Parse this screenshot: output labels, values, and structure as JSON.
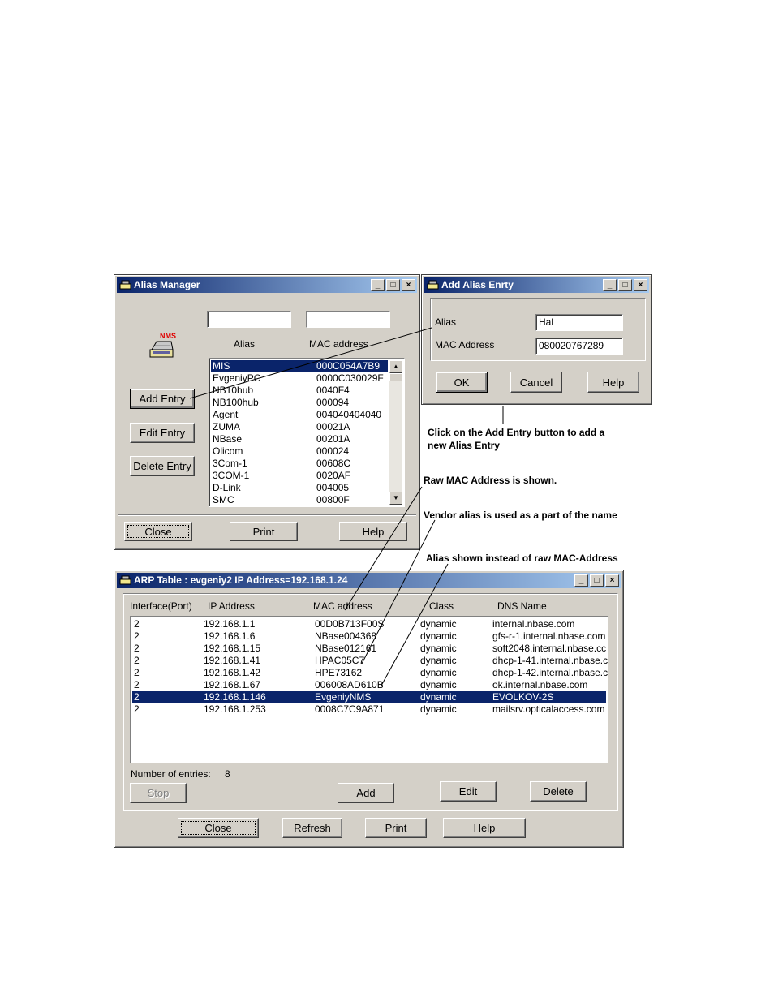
{
  "alias_manager": {
    "title": "Alias Manager",
    "col_alias": "Alias",
    "col_mac": "MAC address",
    "icon_badge": "NMS",
    "buttons": {
      "add": "Add Entry",
      "edit": "Edit Entry",
      "delete": "Delete Entry",
      "close": "Close",
      "print": "Print",
      "help": "Help"
    },
    "rows": [
      {
        "alias": "MIS",
        "mac": "000C054A7B9",
        "selected": true
      },
      {
        "alias": "EvgeniyPC",
        "mac": "0000C030029F"
      },
      {
        "alias": "NB10hub",
        "mac": "0040F4"
      },
      {
        "alias": "NB100hub",
        "mac": "000094"
      },
      {
        "alias": "Agent",
        "mac": "004040404040"
      },
      {
        "alias": "ZUMA",
        "mac": "00021A"
      },
      {
        "alias": "NBase",
        "mac": "00201A"
      },
      {
        "alias": "Olicom",
        "mac": "000024"
      },
      {
        "alias": "3Com-1",
        "mac": "00608C"
      },
      {
        "alias": "3COM-1",
        "mac": "0020AF"
      },
      {
        "alias": "D-Link",
        "mac": "004005"
      },
      {
        "alias": "SMC",
        "mac": "00800F"
      }
    ]
  },
  "add_alias": {
    "title": "Add Alias Enrty",
    "alias_label": "Alias",
    "alias_value": "Hal",
    "mac_label": "MAC Address",
    "mac_value": "080020767289",
    "buttons": {
      "ok": "OK",
      "cancel": "Cancel",
      "help": "Help"
    }
  },
  "annotations": {
    "add_entry": "Click on the Add Entry button to add a\nnew Alias Entry",
    "raw_mac": "Raw MAC Address is shown.",
    "vendor_alias": "Vendor alias is used as a part of the name",
    "alias_instead": "Alias shown instead of raw MAC-Address"
  },
  "arp_table": {
    "title": "ARP Table : evgeniy2 IP Address=192.168.1.24",
    "columns": [
      "Interface(Port)",
      "IP Address",
      "MAC address",
      "Class",
      "DNS Name"
    ],
    "rows": [
      {
        "port": "2",
        "ip": "192.168.1.1",
        "mac": "00D0B713F00S",
        "class": "dynamic",
        "dns": "internal.nbase.com"
      },
      {
        "port": "2",
        "ip": "192.168.1.6",
        "mac": "NBase004368",
        "class": "dynamic",
        "dns": "gfs-r-1.internal.nbase.com"
      },
      {
        "port": "2",
        "ip": "192.168.1.15",
        "mac": "NBase012161",
        "class": "dynamic",
        "dns": "soft2048.internal.nbase.cc"
      },
      {
        "port": "2",
        "ip": "192.168.1.41",
        "mac": "HPAC05C7",
        "class": "dynamic",
        "dns": "dhcp-1-41.internal.nbase.c"
      },
      {
        "port": "2",
        "ip": "192.168.1.42",
        "mac": "HPE73162",
        "class": "dynamic",
        "dns": "dhcp-1-42.internal.nbase.c"
      },
      {
        "port": "2",
        "ip": "192.168.1.67",
        "mac": "006008AD610B",
        "class": "dynamic",
        "dns": "ok.internal.nbase.com"
      },
      {
        "port": "2",
        "ip": "192.168.1.146",
        "mac": "EvgeniyNMS",
        "class": "dynamic",
        "dns": "EVOLKOV-2S",
        "selected": true
      },
      {
        "port": "2",
        "ip": "192.168.1.253",
        "mac": "0008C7C9A871",
        "class": "dynamic",
        "dns": "mailsrv.opticalaccess.com"
      }
    ],
    "entries_label": "Number of entries:",
    "entries_count": "8",
    "buttons": {
      "stop": "Stop",
      "add": "Add",
      "edit": "Edit",
      "delete": "Delete",
      "close": "Close",
      "refresh": "Refresh",
      "print": "Print",
      "help": "Help"
    }
  }
}
